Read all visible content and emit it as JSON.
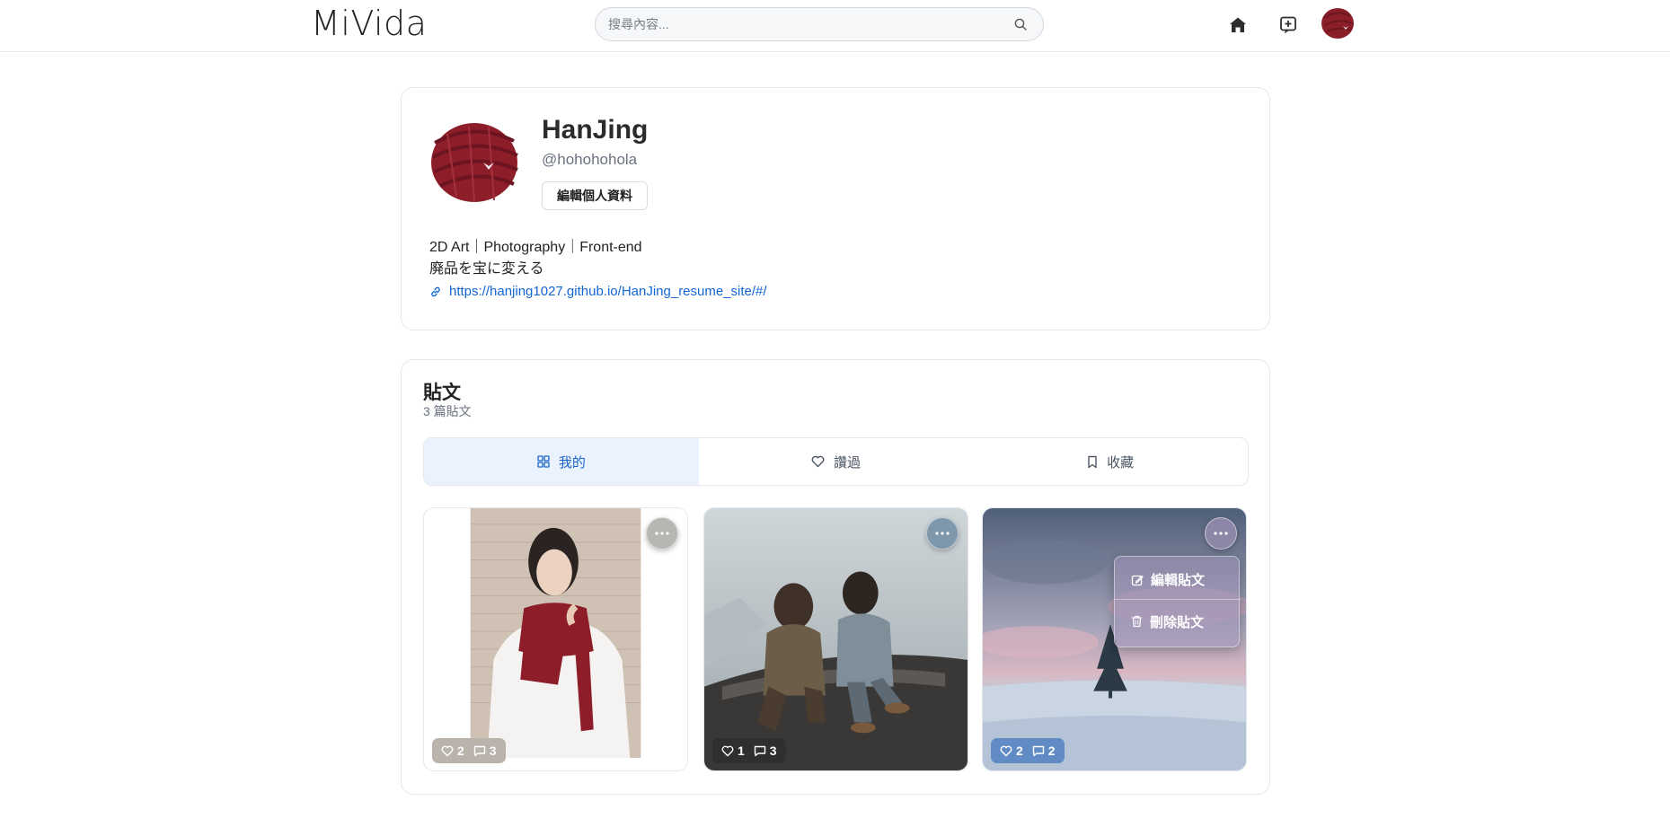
{
  "app": {
    "logo": "MiVida"
  },
  "search": {
    "placeholder": "搜尋內容..."
  },
  "nav": {
    "icons": [
      "home-icon",
      "new-post-icon",
      "avatar"
    ]
  },
  "profile": {
    "name": "HanJing",
    "handle": "@hohohohola",
    "edit_button": "編輯個人資料",
    "bio_line1": "2D Art｜Photography｜Front-end",
    "bio_line2": "廃品を宝に変える",
    "link": "https://hanjing1027.github.io/HanJing_resume_site/#/"
  },
  "posts_section": {
    "title": "貼文",
    "count": "3 篇貼文",
    "tabs": [
      {
        "label": "我的",
        "icon": "grid-icon",
        "active": true
      },
      {
        "label": "讚過",
        "icon": "heart-icon",
        "active": false
      },
      {
        "label": "收藏",
        "icon": "bookmark-icon",
        "active": false
      }
    ],
    "posts": [
      {
        "likes": "2",
        "comments": "3"
      },
      {
        "likes": "1",
        "comments": "3"
      },
      {
        "likes": "2",
        "comments": "2"
      }
    ],
    "post_menu": {
      "edit": "編輯貼文",
      "delete": "刪除貼文"
    }
  },
  "colors": {
    "accent": "#1a64c8",
    "link": "#1366d6",
    "scarf": "#8e1d2a"
  }
}
